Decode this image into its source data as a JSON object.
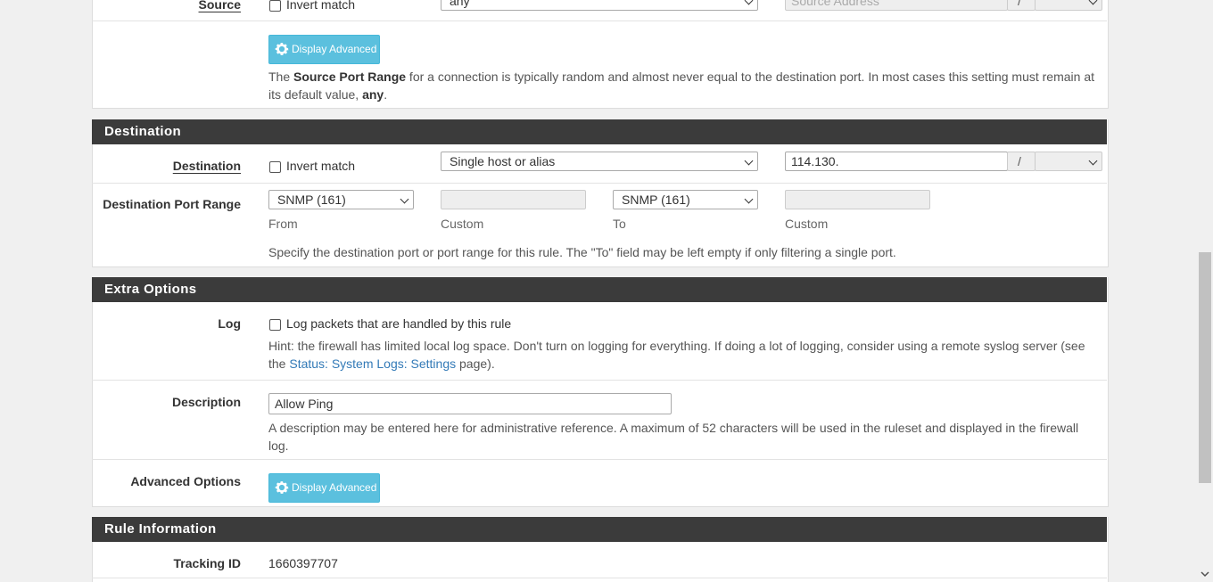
{
  "source": {
    "label": "Source",
    "invert_label": "Invert match",
    "type_value": "any",
    "address_placeholder": "Source Address",
    "slash": "/",
    "advanced_button": "Display Advanced",
    "help_pre": "The ",
    "help_bold": "Source Port Range",
    "help_post": " for a connection is typically random and almost never equal to the destination port. In most cases this setting must remain at its default value, ",
    "help_bold2": "any",
    "help_end": "."
  },
  "destination": {
    "header": "Destination",
    "label": "Destination",
    "invert_label": "Invert match",
    "type_value": "Single host or alias",
    "address_value": "114.130.",
    "slash": "/",
    "port_range_label": "Destination Port Range",
    "from_value": "SNMP (161)",
    "to_value": "SNMP (161)",
    "from_caption": "From",
    "custom_caption_1": "Custom",
    "to_caption": "To",
    "custom_caption_2": "Custom",
    "help": "Specify the destination port or port range for this rule. The \"To\" field may be left empty if only filtering a single port."
  },
  "extra": {
    "header": "Extra Options",
    "log_label": "Log",
    "log_checkbox_label": "Log packets that are handled by this rule",
    "log_help_pre": "Hint: the firewall has limited local log space. Don't turn on logging for everything. If doing a lot of logging, consider using a remote syslog server (see the ",
    "log_help_link": "Status: System Logs: Settings",
    "log_help_post": " page).",
    "description_label": "Description",
    "description_value": "Allow Ping",
    "description_help": "A description may be entered here for administrative reference. A maximum of 52 characters will be used in the ruleset and displayed in the firewall log.",
    "advanced_label": "Advanced Options",
    "advanced_button": "Display Advanced"
  },
  "rule_info": {
    "header": "Rule Information",
    "tracking_label": "Tracking ID",
    "tracking_value": "1660397707"
  }
}
